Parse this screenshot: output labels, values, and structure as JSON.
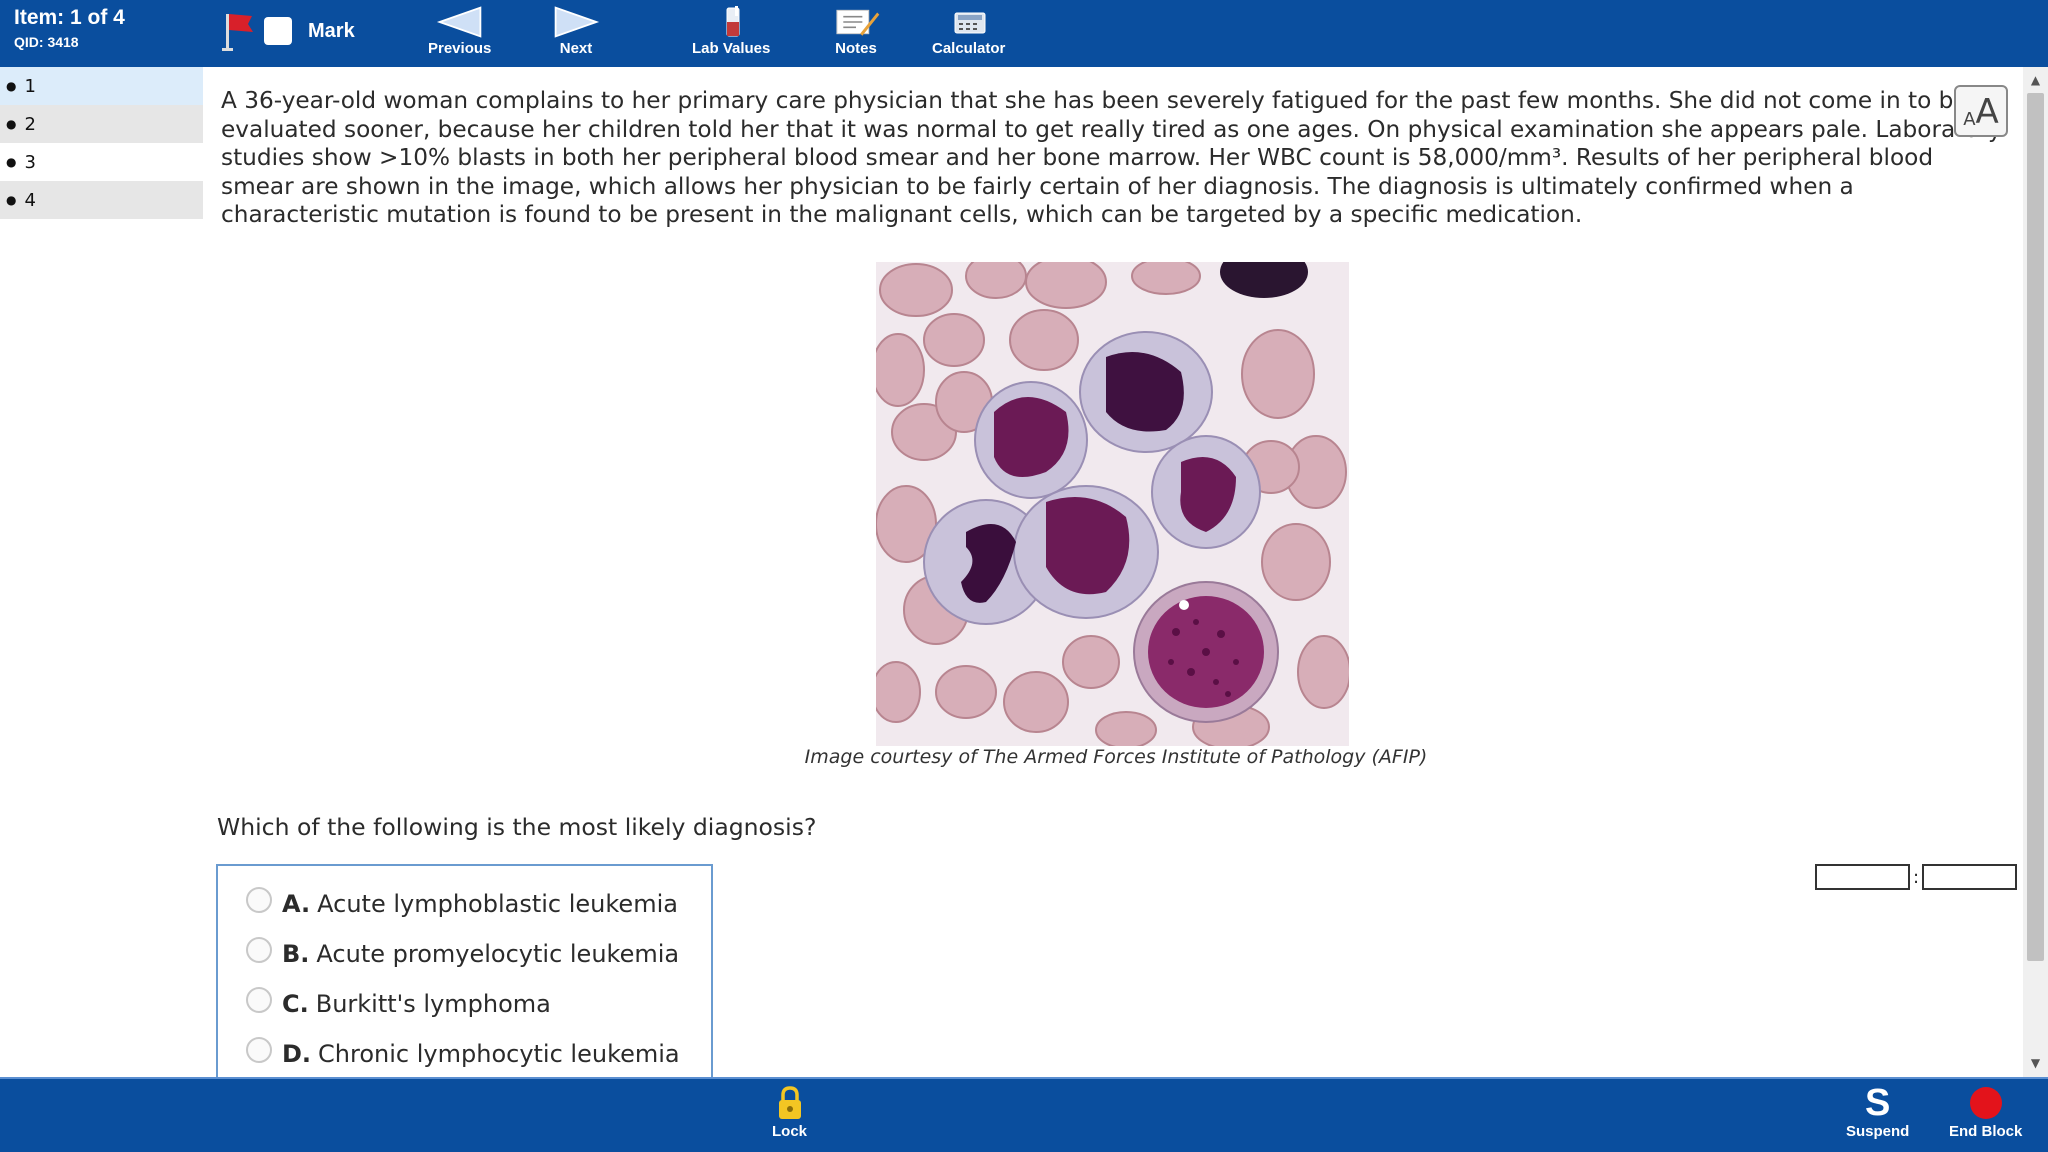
{
  "header": {
    "item_label": "Item: 1 of 4",
    "qid_label": "QID: 3418",
    "mark_label": "Mark",
    "tools": {
      "previous": "Previous",
      "next": "Next",
      "lab_values": "Lab Values",
      "notes": "Notes",
      "calculator": "Calculator"
    }
  },
  "sidebar": {
    "items": [
      {
        "label": "1",
        "state": "active"
      },
      {
        "label": "2",
        "state": "alt"
      },
      {
        "label": "3",
        "state": "plain"
      },
      {
        "label": "4",
        "state": "alt"
      }
    ]
  },
  "question": {
    "stem": "A 36-year-old woman complains to her primary care physician that she has been severely fatigued for the past few months. She did not come in to be evaluated sooner, because her children told her that it was normal to get really tired as one ages. On physical examination she appears pale. Laboratory studies show >10% blasts in both her peripheral blood smear and her bone marrow. Her WBC count is 58,000/mm³. Results of her peripheral blood smear are shown in the image, which allows her physician to be fairly certain of her diagnosis. The diagnosis is ultimately confirmed when a characteristic mutation is found to be present in the malignant cells, which can be targeted by a specific medication.",
    "image_caption": "Image courtesy of The Armed Forces Institute of Pathology (AFIP)",
    "prompt": "Which of the following is the most likely diagnosis?",
    "answers": [
      {
        "letter": "A.",
        "text": "Acute lymphoblastic leukemia"
      },
      {
        "letter": "B.",
        "text": "Acute promyelocytic leukemia"
      },
      {
        "letter": "C.",
        "text": "Burkitt's lymphoma"
      },
      {
        "letter": "D.",
        "text": "Chronic lymphocytic leukemia"
      }
    ],
    "font_size_button": {
      "small": "A",
      "large": "A"
    },
    "timer_separator": ":"
  },
  "footer": {
    "lock": "Lock",
    "suspend_glyph": "S",
    "suspend": "Suspend",
    "end_block": "End Block"
  },
  "colors": {
    "bar_blue": "#0a4e9e",
    "active_item": "#dcecfa",
    "alt_item": "#e6e6e6",
    "flag_red": "#d8202a",
    "lock_yellow": "#f3c623",
    "end_red": "#e3131b"
  },
  "icons": {
    "flag": "flag-icon",
    "previous": "left-arrow-icon",
    "next": "right-arrow-icon",
    "lab_values": "lab-flask-icon",
    "notes": "notepad-pencil-icon",
    "calculator": "calculator-icon",
    "lock": "padlock-icon",
    "end_block": "stop-circle-icon"
  }
}
